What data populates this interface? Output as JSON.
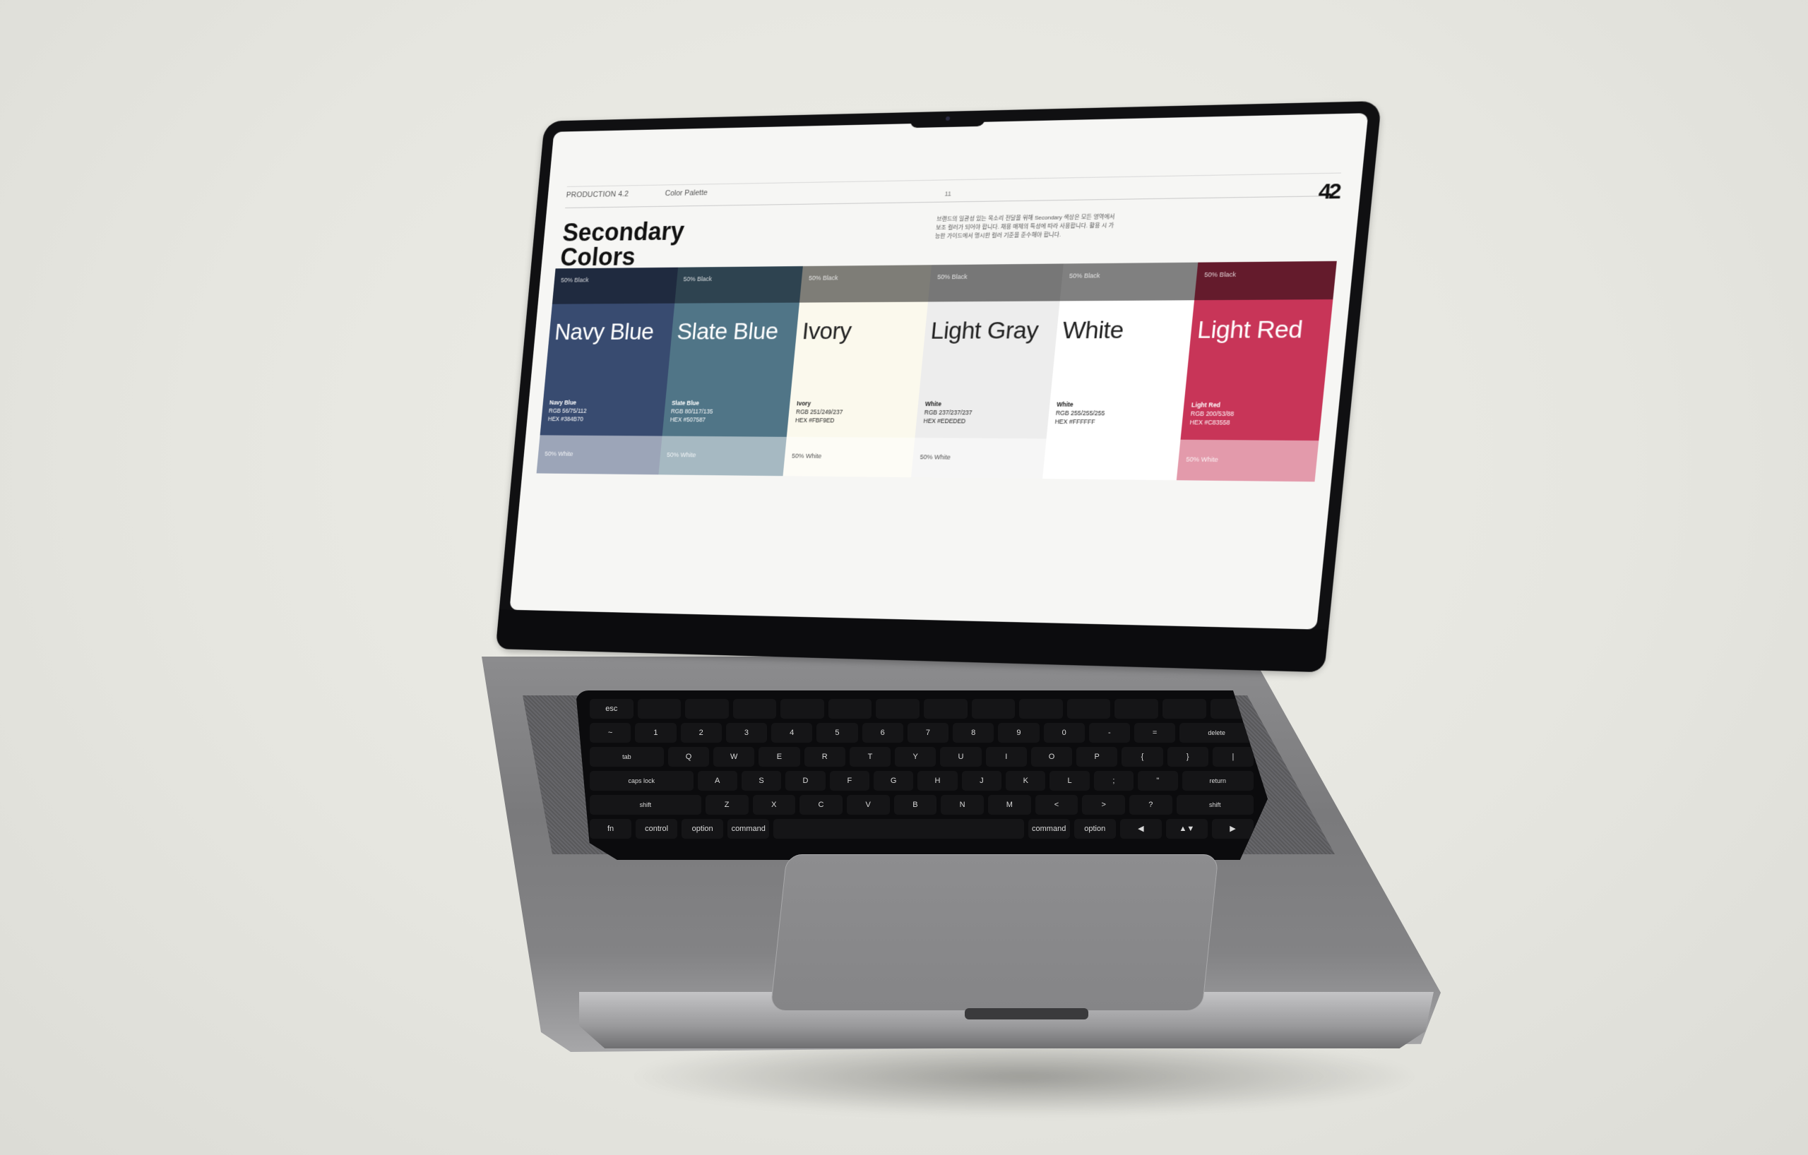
{
  "slide": {
    "production_label": "PRODUCTION 4.2",
    "section_label": "Color Palette",
    "page_number": "11",
    "logo_text": "42",
    "heading": "Secondary Colors",
    "description": "브랜드의 일관성 있는 목소리 전달을 위해 Secondary 색상은 모든 영역에서 보조 컬러가 되어야 합니다. 채용 매체의 특성에 따라 사용합니다. 활용 시 가능한 가이드에서 명시한 컬러 기준을 준수해야 합니다."
  },
  "swatches": [
    {
      "title": "Navy Blue",
      "dark_label": "50% Black",
      "light_label": "50% White",
      "name": "Navy Blue",
      "rgb": "RGB 56/75/112",
      "hex": "HEX #384B70",
      "color": "#384B70",
      "dark": "#1f2a3f",
      "light": "#9ca5b8",
      "text": "#ffffff"
    },
    {
      "title": "Slate Blue",
      "dark_label": "50% Black",
      "light_label": "50% White",
      "name": "Slate Blue",
      "rgb": "RGB 80/117/135",
      "hex": "HEX #507587",
      "color": "#507587",
      "dark": "#2e4350",
      "light": "#a6b9c2",
      "text": "#ffffff"
    },
    {
      "title": "Ivory",
      "dark_label": "50% Black",
      "light_label": "50% White",
      "name": "Ivory",
      "rgb": "RGB 251/249/237",
      "hex": "HEX #FBF9ED",
      "color": "#FBF9ED",
      "dark": "#7e7d77",
      "light": "#fdfcf6",
      "text": "#222222"
    },
    {
      "title": "Light Gray",
      "dark_label": "50% Black",
      "light_label": "50% White",
      "name": "White",
      "rgb": "RGB 237/237/237",
      "hex": "HEX #EDEDED",
      "color": "#EDEDED",
      "dark": "#777777",
      "light": "#f6f6f6",
      "text": "#222222"
    },
    {
      "title": "White",
      "dark_label": "50% Black",
      "light_label": "",
      "name": "White",
      "rgb": "RGB 255/255/255",
      "hex": "HEX #FFFFFF",
      "color": "#FFFFFF",
      "dark": "#808080",
      "light": "#ffffff",
      "text": "#222222"
    },
    {
      "title": "Light Red",
      "dark_label": "50% Black",
      "light_label": "50% White",
      "name": "Light Red",
      "rgb": "RGB 200/53/88",
      "hex": "HEX #C83558",
      "color": "#C83558",
      "dark": "#641b2c",
      "light": "#e39aab",
      "text": "#ffffff"
    }
  ],
  "keyboard": {
    "rows": [
      [
        "esc",
        "",
        "",
        "",
        "",
        "",
        "",
        "",
        "",
        "",
        "",
        "",
        "",
        ""
      ],
      [
        "~",
        "1",
        "2",
        "3",
        "4",
        "5",
        "6",
        "7",
        "8",
        "9",
        "0",
        "-",
        "=",
        "delete"
      ],
      [
        "tab",
        "Q",
        "W",
        "E",
        "R",
        "T",
        "Y",
        "U",
        "I",
        "O",
        "P",
        "{",
        "}",
        "|"
      ],
      [
        "caps lock",
        "A",
        "S",
        "D",
        "F",
        "G",
        "H",
        "J",
        "K",
        "L",
        ";",
        "\"",
        "return"
      ],
      [
        "shift",
        "Z",
        "X",
        "C",
        "V",
        "B",
        "N",
        "M",
        "<",
        ">",
        "?",
        "shift"
      ],
      [
        "fn",
        "control",
        "option",
        "command",
        "",
        "command",
        "option",
        "◀",
        "▲▼",
        "▶"
      ]
    ]
  }
}
